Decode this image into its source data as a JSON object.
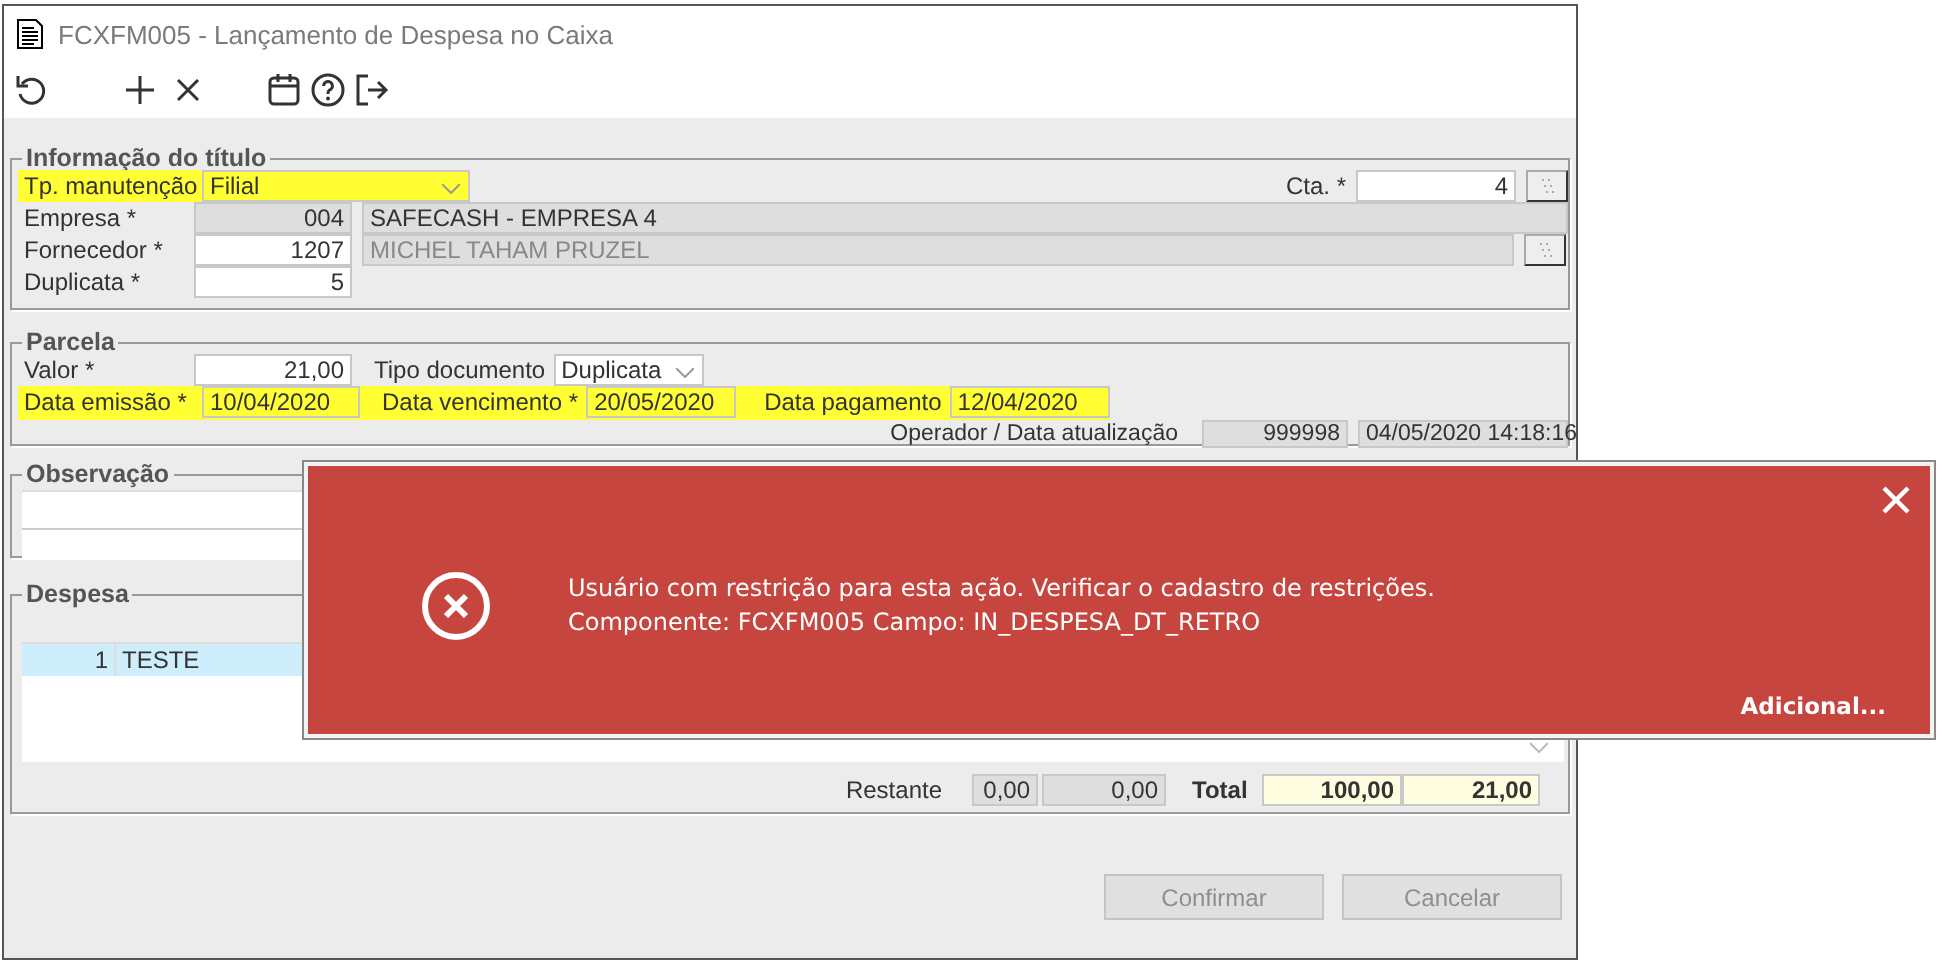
{
  "window": {
    "title": "FCXFM005 - Lançamento de Despesa no Caixa"
  },
  "toolbar": [
    {
      "kind": "undo"
    },
    {
      "kind": "add"
    },
    {
      "kind": "delete"
    },
    {
      "kind": "calendar"
    },
    {
      "kind": "help"
    },
    {
      "kind": "exit"
    }
  ],
  "info": {
    "legend": "Informação do título",
    "maintenance": {
      "label": "Tp. manutenção",
      "value": "Filial",
      "highlighted": true
    },
    "account": {
      "label": "Cta. *",
      "value": "4"
    },
    "company": {
      "label": "Empresa *",
      "code": "004",
      "name": "SAFECASH -  EMPRESA 4"
    },
    "supplier": {
      "label": "Fornecedor *",
      "code": "1207",
      "name": "MICHEL TAHAM PRUZEL"
    },
    "duplicate": {
      "label": "Duplicata *",
      "value": "5"
    }
  },
  "installment": {
    "legend": "Parcela",
    "amount": {
      "label": "Valor *",
      "value": "21,00"
    },
    "doc_type": {
      "label": "Tipo documento",
      "value": "Duplicata"
    },
    "dates_highlighted": true,
    "issue_date": {
      "label": "Data emissão *",
      "value": "10/04/2020"
    },
    "due_date": {
      "label": "Data vencimento *",
      "value": "20/05/2020"
    },
    "payment_date": {
      "label": "Data pagamento",
      "value": "12/04/2020"
    },
    "operator": {
      "label": "Operador / Data atualização",
      "code": "999998",
      "timestamp": "04/05/2020 14:18:16"
    }
  },
  "notes": {
    "legend": "Observação"
  },
  "expense": {
    "legend": "Despesa",
    "rows": [
      {
        "number": "1",
        "description": "TESTE",
        "selected": true
      }
    ],
    "remaining": {
      "label": "Restante",
      "values": [
        "0,00",
        "0,00"
      ]
    },
    "total": {
      "label": "Total",
      "values": [
        "100,00",
        "21,00"
      ]
    }
  },
  "buttons": [
    {
      "label": "Confirmar",
      "disabled": true
    },
    {
      "label": "Cancelar",
      "disabled": true
    }
  ],
  "alert": {
    "message": "Usuário com restrição para esta ação. Verificar o cadastro de restrições.",
    "detail": "Componente: FCXFM005 Campo: IN_DESPESA_DT_RETRO",
    "more": "Adicional..."
  }
}
